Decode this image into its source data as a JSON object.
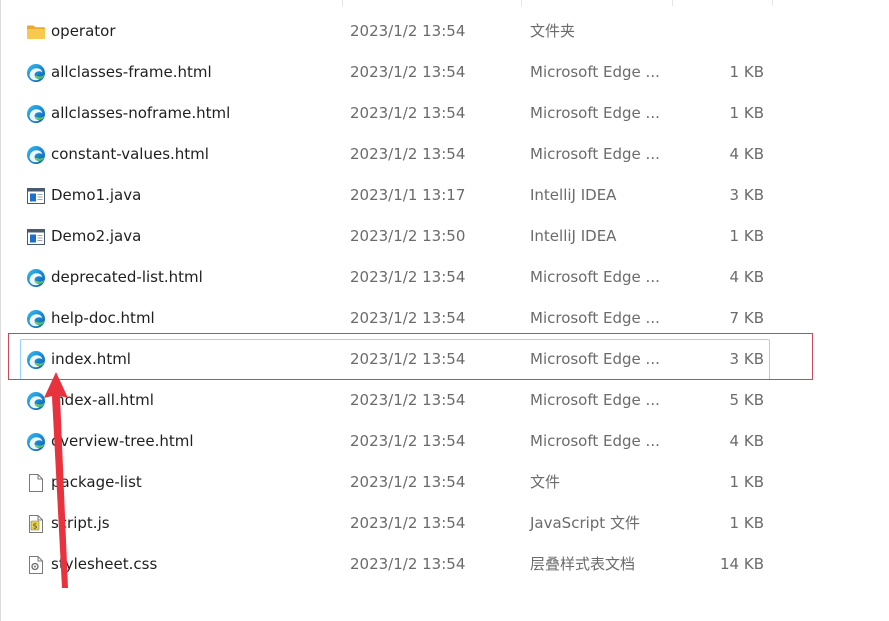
{
  "files": [
    {
      "name": "operator",
      "date": "2023/1/2 13:54",
      "type": "文件夹",
      "size": "",
      "icon": "folder-icon"
    },
    {
      "name": "allclasses-frame.html",
      "date": "2023/1/2 13:54",
      "type": "Microsoft Edge ...",
      "size": "1 KB",
      "icon": "edge-icon"
    },
    {
      "name": "allclasses-noframe.html",
      "date": "2023/1/2 13:54",
      "type": "Microsoft Edge ...",
      "size": "1 KB",
      "icon": "edge-icon"
    },
    {
      "name": "constant-values.html",
      "date": "2023/1/2 13:54",
      "type": "Microsoft Edge ...",
      "size": "4 KB",
      "icon": "edge-icon"
    },
    {
      "name": "Demo1.java",
      "date": "2023/1/1 13:17",
      "type": "IntelliJ IDEA",
      "size": "3 KB",
      "icon": "java-file-icon"
    },
    {
      "name": "Demo2.java",
      "date": "2023/1/2 13:50",
      "type": "IntelliJ IDEA",
      "size": "1 KB",
      "icon": "java-file-icon"
    },
    {
      "name": "deprecated-list.html",
      "date": "2023/1/2 13:54",
      "type": "Microsoft Edge ...",
      "size": "4 KB",
      "icon": "edge-icon"
    },
    {
      "name": "help-doc.html",
      "date": "2023/1/2 13:54",
      "type": "Microsoft Edge ...",
      "size": "7 KB",
      "icon": "edge-icon"
    },
    {
      "name": "index.html",
      "date": "2023/1/2 13:54",
      "type": "Microsoft Edge ...",
      "size": "3 KB",
      "icon": "edge-icon",
      "selected": true
    },
    {
      "name": "index-all.html",
      "date": "2023/1/2 13:54",
      "type": "Microsoft Edge ...",
      "size": "5 KB",
      "icon": "edge-icon"
    },
    {
      "name": "overview-tree.html",
      "date": "2023/1/2 13:54",
      "type": "Microsoft Edge ...",
      "size": "4 KB",
      "icon": "edge-icon"
    },
    {
      "name": "package-list",
      "date": "2023/1/2 13:54",
      "type": "文件",
      "size": "1 KB",
      "icon": "blank-file-icon"
    },
    {
      "name": "script.js",
      "date": "2023/1/2 13:54",
      "type": "JavaScript 文件",
      "size": "1 KB",
      "icon": "js-file-icon"
    },
    {
      "name": "stylesheet.css",
      "date": "2023/1/2 13:54",
      "type": "层叠样式表文档",
      "size": "14 KB",
      "icon": "css-file-icon"
    }
  ],
  "annotation": {
    "highlight_color": "#c84a55",
    "arrow_color": "#e8333f",
    "target_file": "index.html"
  },
  "colors": {
    "selection_border": "#99d1ff",
    "secondary_text": "#6b6b6b",
    "primary_text": "#1f1f1f"
  }
}
